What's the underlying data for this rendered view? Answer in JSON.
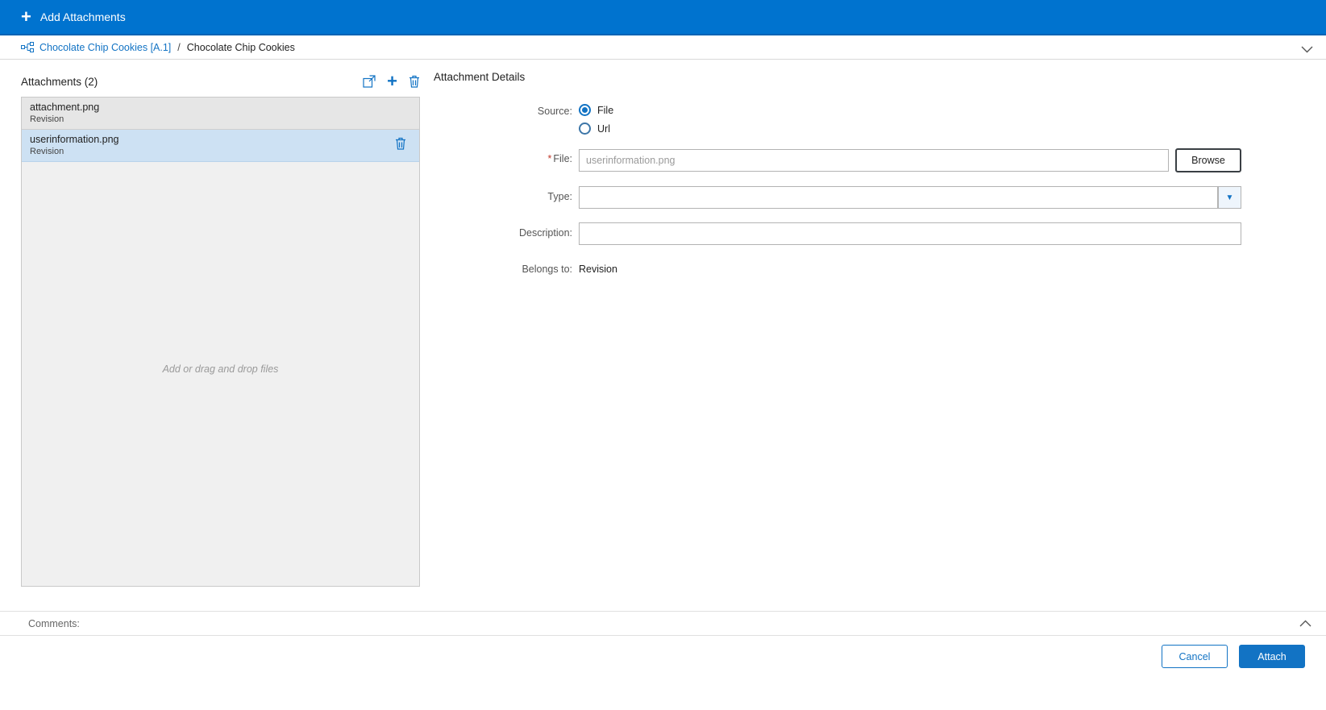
{
  "colors": {
    "header_bg": "#0073cf",
    "accent": "#1273c4",
    "selected_item_bg": "#cde1f3"
  },
  "icons": {
    "plus": "+",
    "caret_down": "▼"
  },
  "header": {
    "title": "Add Attachments"
  },
  "breadcrumb": {
    "link": "Chocolate Chip Cookies [A.1]",
    "separator": "/",
    "current": "Chocolate Chip Cookies"
  },
  "attachments_panel": {
    "title": "Attachments (2)",
    "items": [
      {
        "name": "attachment.png",
        "belongs": "Revision"
      },
      {
        "name": "userinformation.png",
        "belongs": "Revision"
      }
    ],
    "dropzone_hint": "Add or drag and drop files"
  },
  "details": {
    "title": "Attachment Details",
    "source_label": "Source:",
    "source_options": [
      {
        "label": "File",
        "selected": true
      },
      {
        "label": "Url",
        "selected": false
      }
    ],
    "file_required_mark": "*",
    "file_label": "File:",
    "file_value": "userinformation.png",
    "browse_label": "Browse",
    "type_label": "Type:",
    "type_value": "",
    "description_label": "Description:",
    "description_value": "",
    "belongs_label": "Belongs to:",
    "belongs_value": "Revision"
  },
  "comments": {
    "label": "Comments:"
  },
  "footer": {
    "cancel": "Cancel",
    "attach": "Attach"
  }
}
